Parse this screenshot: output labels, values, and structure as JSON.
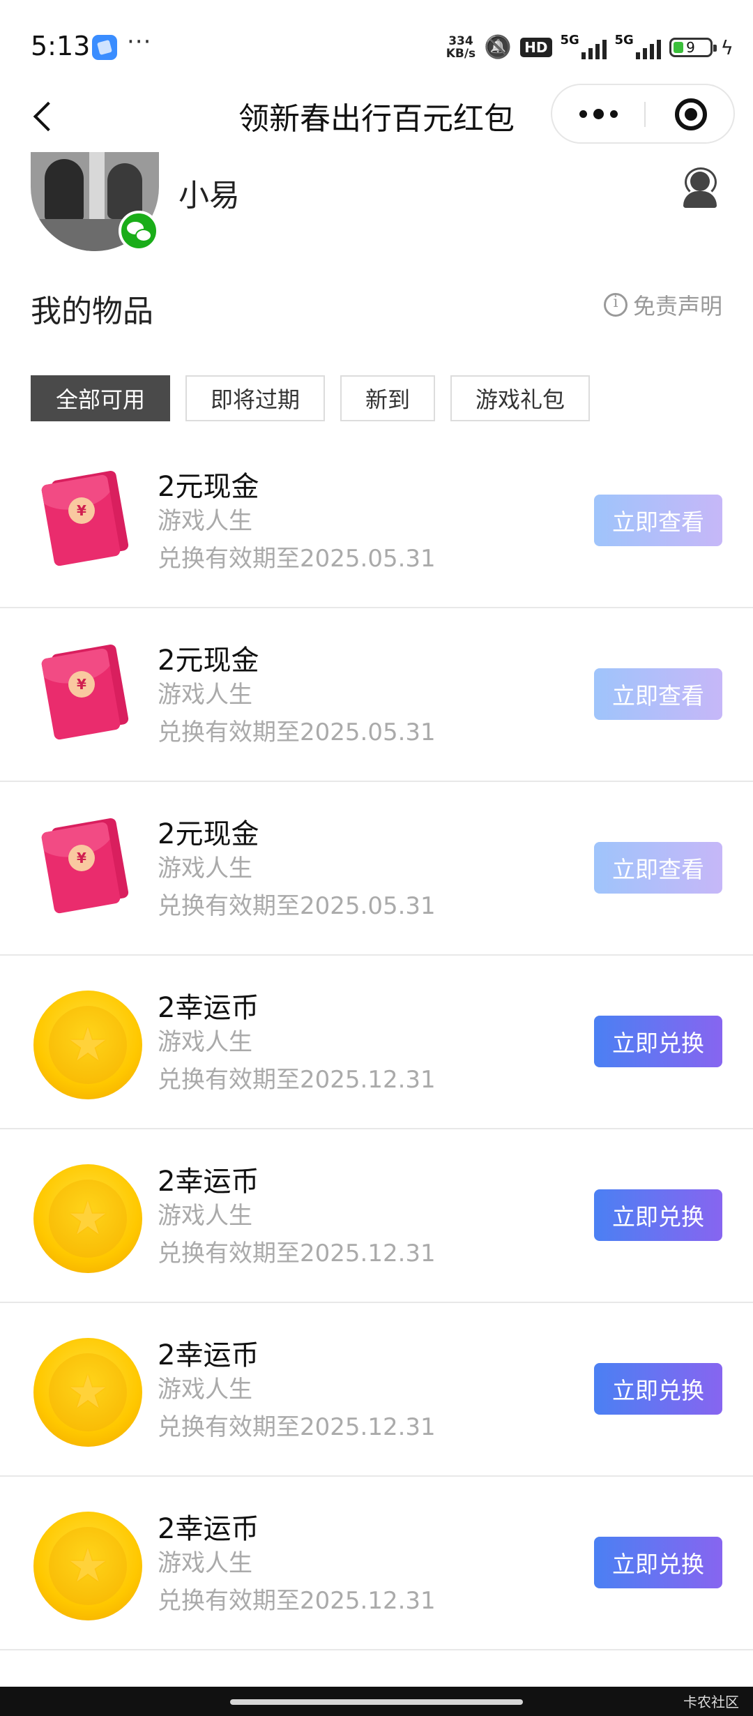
{
  "status_bar": {
    "time": "5:13",
    "more": "···",
    "net_speed_value": "334",
    "net_speed_unit": "KB/s",
    "hd": "HD",
    "signal1": "5G",
    "signal2": "5G",
    "battery": "9"
  },
  "navbar": {
    "title": "领新春出行百元红包"
  },
  "profile": {
    "username": "小易"
  },
  "section": {
    "title": "我的物品",
    "disclaimer": "免责声明"
  },
  "tabs": [
    {
      "label": "全部可用",
      "active": true
    },
    {
      "label": "即将过期",
      "active": false
    },
    {
      "label": "新到",
      "active": false
    },
    {
      "label": "游戏礼包",
      "active": false
    }
  ],
  "items": [
    {
      "type": "redpacket",
      "name": "2元现金",
      "source": "游戏人生",
      "expiry": "兑换有效期至2025.05.31",
      "action": "立即查看"
    },
    {
      "type": "redpacket",
      "name": "2元现金",
      "source": "游戏人生",
      "expiry": "兑换有效期至2025.05.31",
      "action": "立即查看"
    },
    {
      "type": "redpacket",
      "name": "2元现金",
      "source": "游戏人生",
      "expiry": "兑换有效期至2025.05.31",
      "action": "立即查看"
    },
    {
      "type": "coin",
      "name": "2幸运币",
      "source": "游戏人生",
      "expiry": "兑换有效期至2025.12.31",
      "action": "立即兑换"
    },
    {
      "type": "coin",
      "name": "2幸运币",
      "source": "游戏人生",
      "expiry": "兑换有效期至2025.12.31",
      "action": "立即兑换"
    },
    {
      "type": "coin",
      "name": "2幸运币",
      "source": "游戏人生",
      "expiry": "兑换有效期至2025.12.31",
      "action": "立即兑换"
    },
    {
      "type": "coin",
      "name": "2幸运币",
      "source": "游戏人生",
      "expiry": "兑换有效期至2025.12.31",
      "action": "立即兑换"
    }
  ],
  "icons": {
    "redpacket_symbol": "¥",
    "coin_symbol": "★"
  },
  "watermark": "卡农社区"
}
